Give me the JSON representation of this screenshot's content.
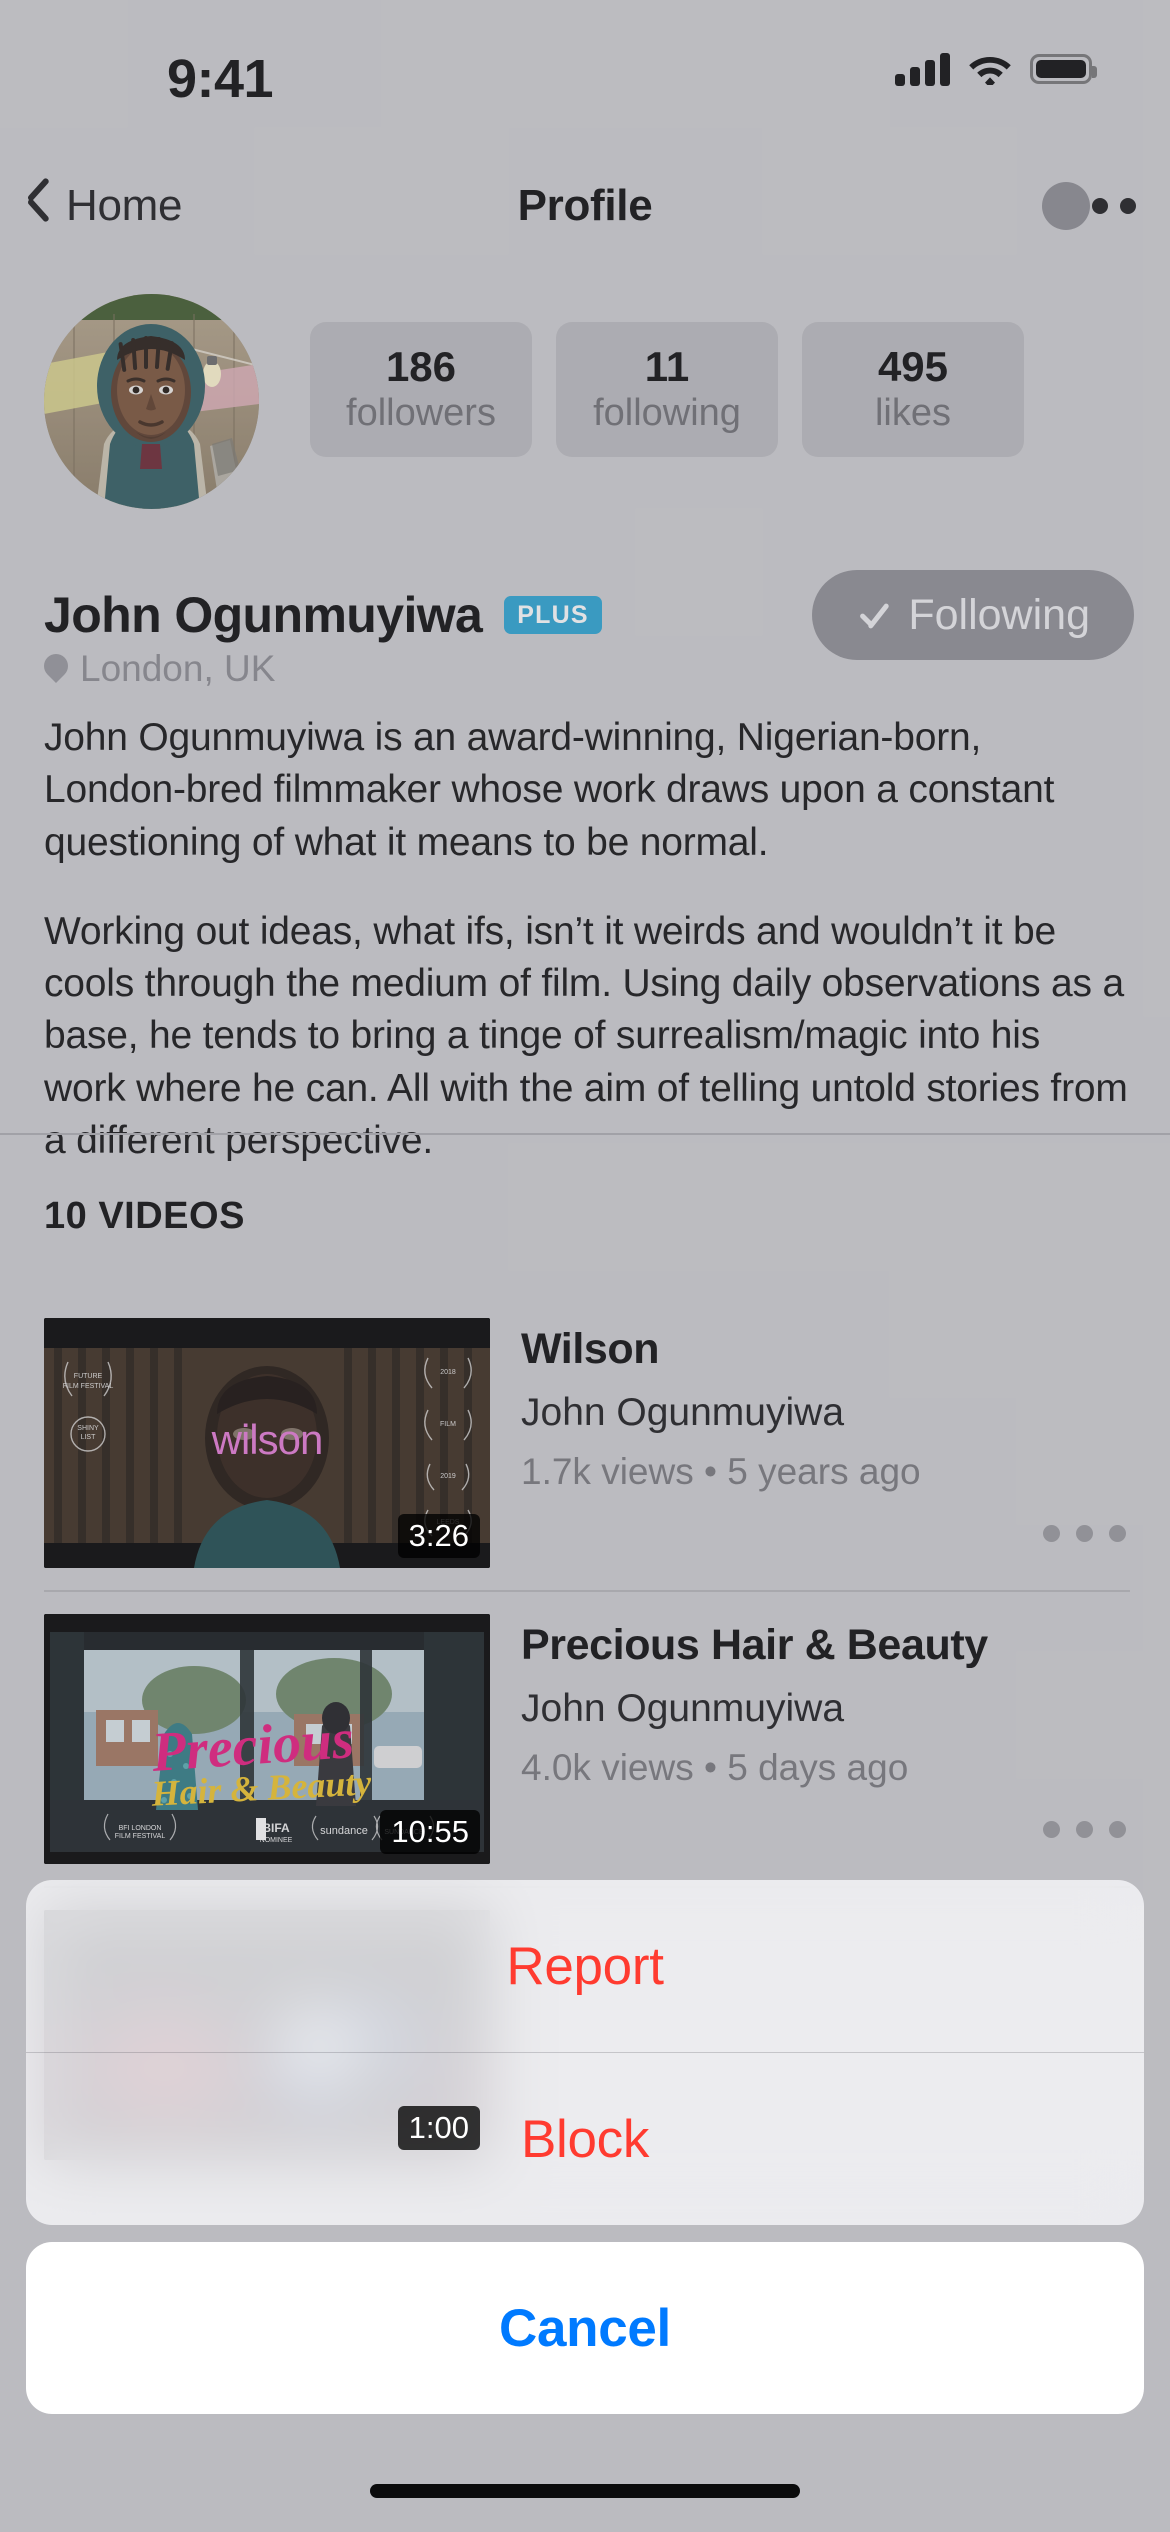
{
  "status_bar": {
    "time": "9:41",
    "signal_icon": "cellular-signal-icon",
    "wifi_icon": "wifi-icon",
    "battery_icon": "battery-icon"
  },
  "nav_bar": {
    "back_label": "Home",
    "back_icon": "chevron-left-icon",
    "title": "Profile",
    "more_icon": "more-options-icon"
  },
  "profile": {
    "avatar_alt": "John Ogunmuyiwa profile photo",
    "name": "John Ogunmuyiwa",
    "plus_badge": "PLUS",
    "location": "London, UK",
    "location_icon": "location-pin-icon",
    "follow_button": {
      "label": "Following",
      "icon": "checkmark-icon",
      "state": "following"
    },
    "stats": [
      {
        "value": "186",
        "label": "followers"
      },
      {
        "value": "11",
        "label": "following"
      },
      {
        "value": "495",
        "label": "likes"
      }
    ],
    "bio": [
      "John Ogunmuyiwa is an award-winning, Nigerian-born, London-bred filmmaker whose work draws upon a constant questioning of what it means to be normal.",
      "Working out ideas, what ifs, isn’t it weirds and wouldn’t it be cools through the medium of film. Using daily observations as a base, he tends to bring a tinge of surrealism/magic into his work where he can. All with the aim of telling untold stories from a different perspective."
    ]
  },
  "videos_section": {
    "heading": "10 VIDEOS",
    "items": [
      {
        "title": "Wilson",
        "author": "John Ogunmuyiwa",
        "meta": "1.7k views • 5 years ago",
        "duration": "3:26",
        "thumb_caption": "wilson",
        "more_icon": "more-options-icon"
      },
      {
        "title": "Precious Hair & Beauty",
        "author": "John Ogunmuyiwa",
        "meta": "4.0k views • 5 days ago",
        "duration": "10:55",
        "thumb_caption_primary": "Precious",
        "thumb_caption_secondary": "Hair & Beauty",
        "more_icon": "more-options-icon"
      },
      {
        "duration": "1:00"
      }
    ]
  },
  "action_sheet": {
    "report_label": "Report",
    "block_label": "Block",
    "cancel_label": "Cancel"
  },
  "colors": {
    "destructive": "#ff3b30",
    "accent_blue": "#007aff",
    "plus_badge_bg": "#2aa5d4",
    "page_bg": "#cfcfd2"
  }
}
